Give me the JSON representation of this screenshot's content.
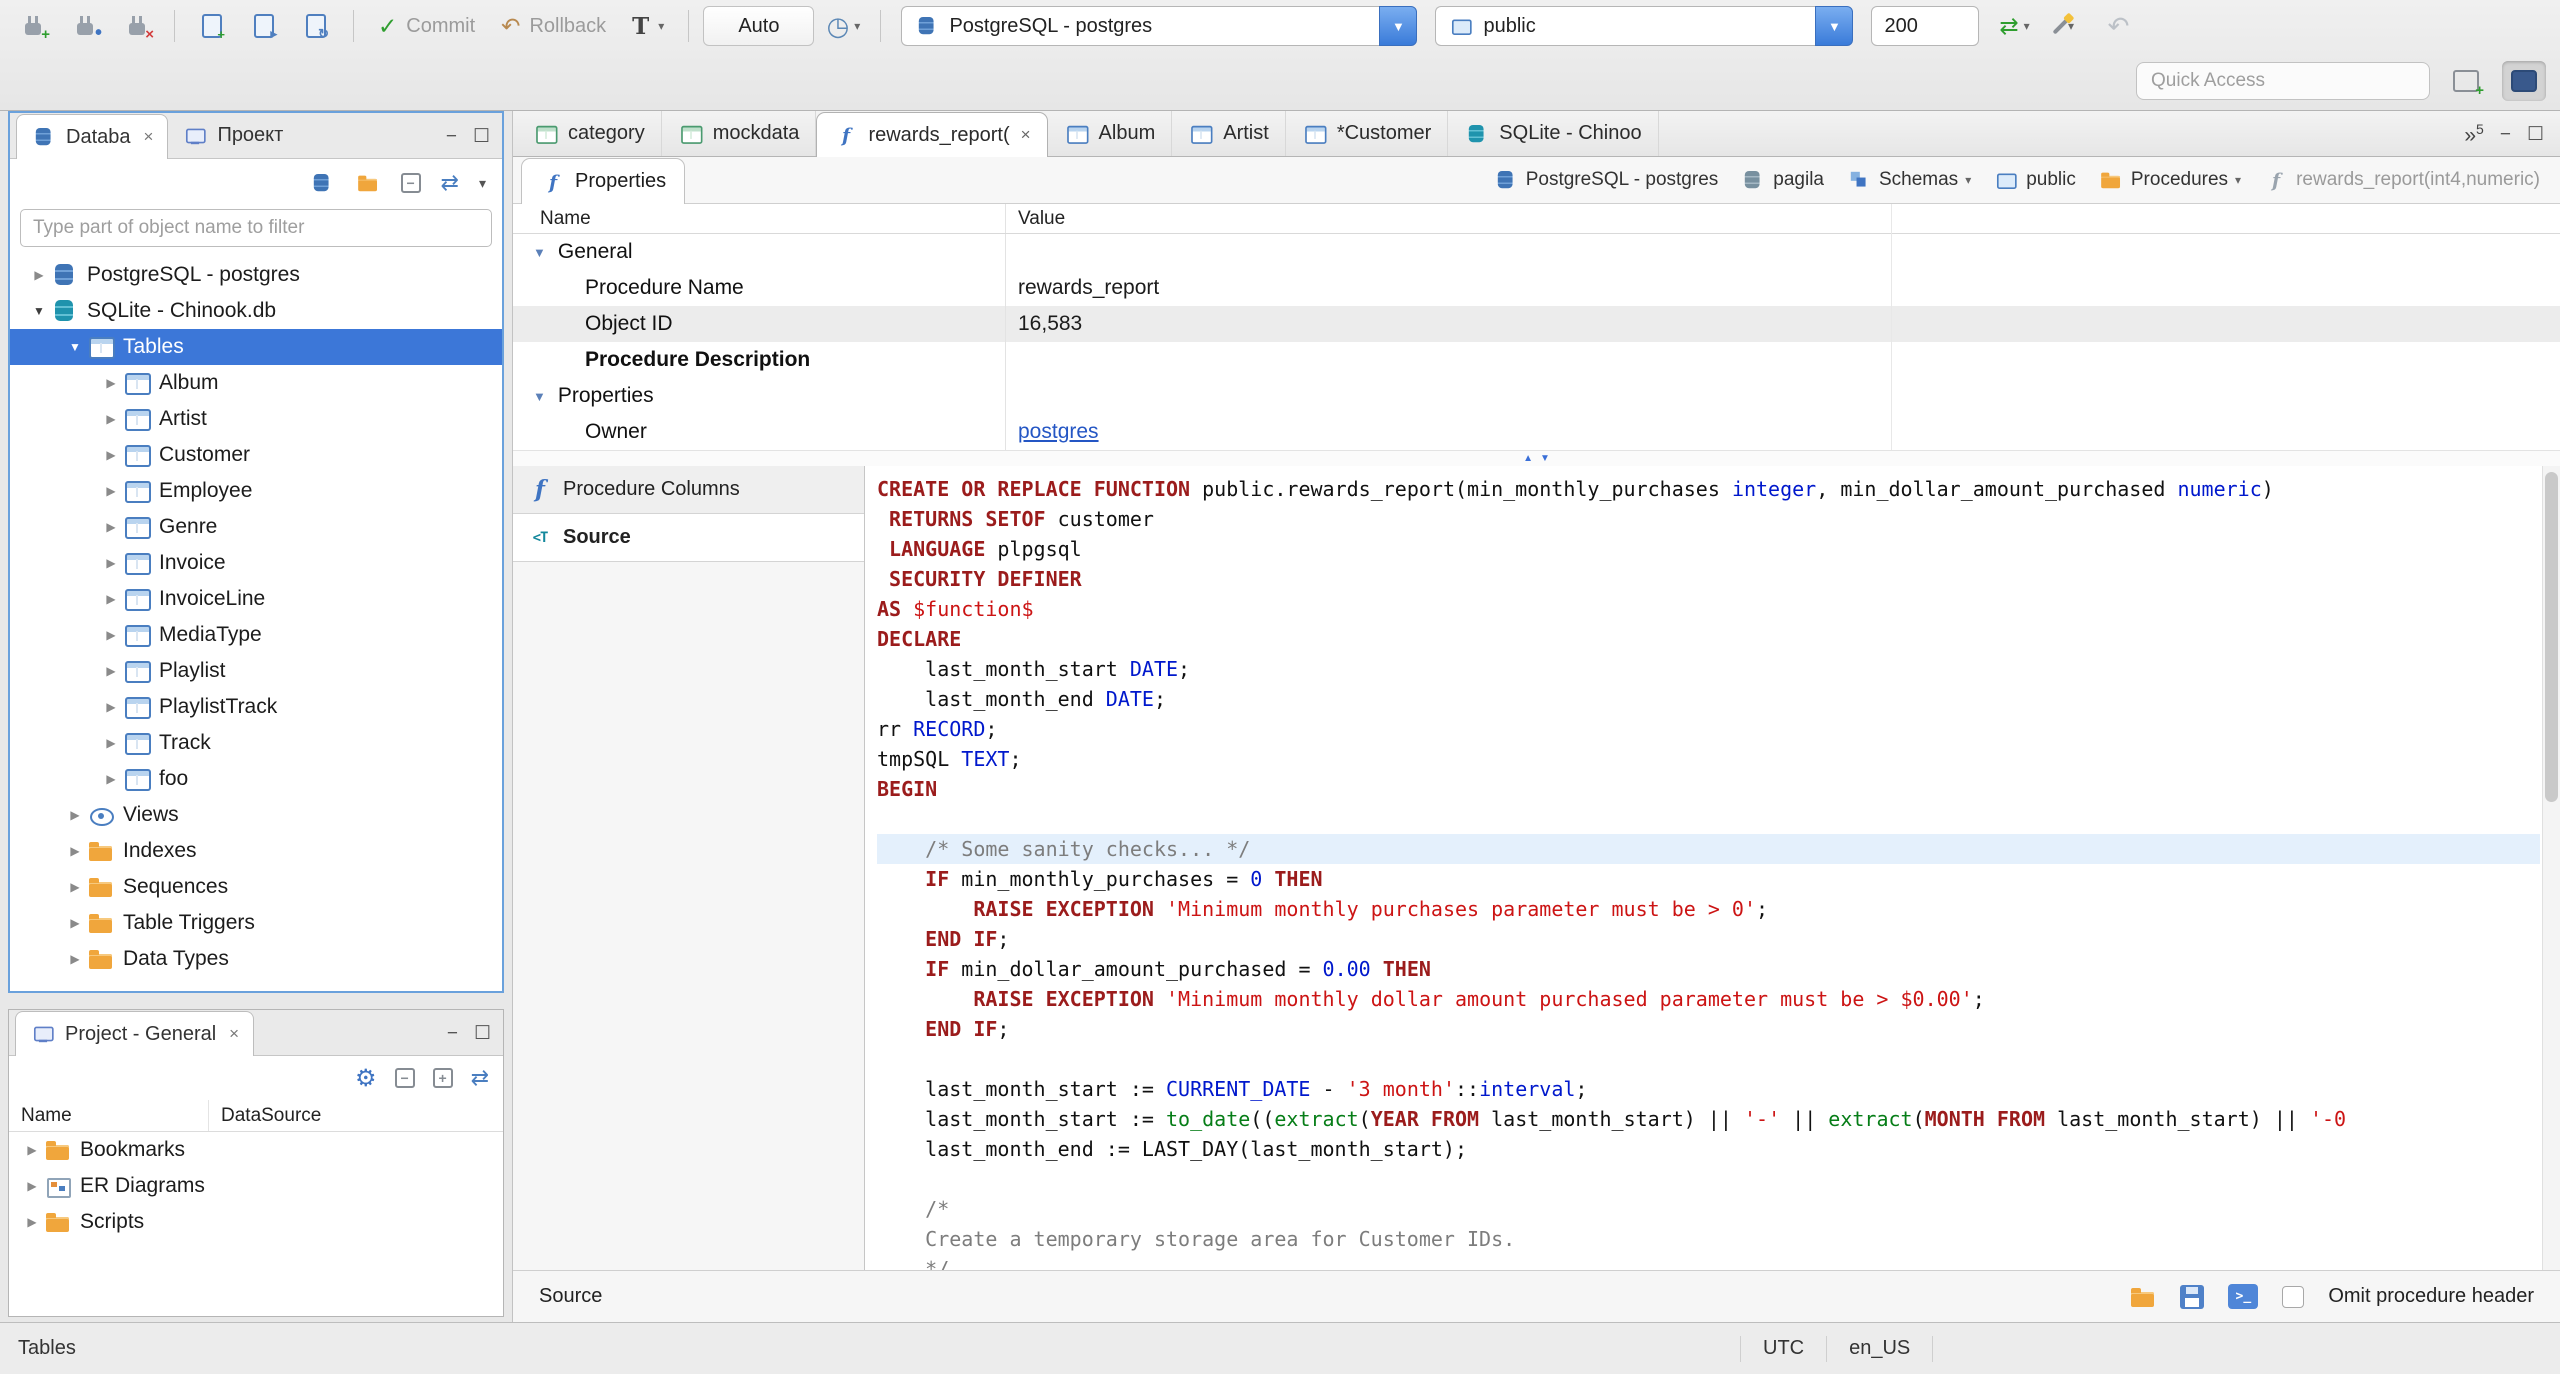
{
  "colors": {
    "selection_blue": "#3c77d8",
    "focus_border": "#6aa1dc",
    "keyword": "#9b1c1c",
    "string": "#cc1414",
    "type": "#0018cc",
    "comment": "#7d7d7d",
    "function": "#067d17",
    "link": "#2456c4",
    "current_line": "#e4f0fc",
    "folder_orange": "#f0a63c"
  },
  "toolbar": {
    "commit_label": "Commit",
    "rollback_label": "Rollback",
    "transaction_letter": "T",
    "auto_label": "Auto",
    "connection_value": "PostgreSQL - postgres",
    "schema_value": "public",
    "fetch_size_value": "200",
    "quick_access_placeholder": "Quick Access"
  },
  "sidebar": {
    "tabs": [
      {
        "label": "Databa",
        "active": true
      },
      {
        "label": "Проект",
        "active": false
      }
    ],
    "filter_placeholder": "Type part of object name to filter",
    "tree": [
      {
        "depth": 0,
        "arrow": "right",
        "icon": "db-pg",
        "label": "PostgreSQL - postgres"
      },
      {
        "depth": 0,
        "arrow": "down",
        "icon": "db-sqlite",
        "label": "SQLite - Chinook.db"
      },
      {
        "depth": 1,
        "arrow": "down",
        "icon": "table",
        "label": "Tables",
        "selected": true
      },
      {
        "depth": 2,
        "arrow": "right",
        "icon": "table",
        "label": "Album"
      },
      {
        "depth": 2,
        "arrow": "right",
        "icon": "table",
        "label": "Artist"
      },
      {
        "depth": 2,
        "arrow": "right",
        "icon": "table",
        "label": "Customer"
      },
      {
        "depth": 2,
        "arrow": "right",
        "icon": "table",
        "label": "Employee"
      },
      {
        "depth": 2,
        "arrow": "right",
        "icon": "table",
        "label": "Genre"
      },
      {
        "depth": 2,
        "arrow": "right",
        "icon": "table",
        "label": "Invoice"
      },
      {
        "depth": 2,
        "arrow": "right",
        "icon": "table",
        "label": "InvoiceLine"
      },
      {
        "depth": 2,
        "arrow": "right",
        "icon": "table",
        "label": "MediaType"
      },
      {
        "depth": 2,
        "arrow": "right",
        "icon": "table",
        "label": "Playlist"
      },
      {
        "depth": 2,
        "arrow": "right",
        "icon": "table",
        "label": "PlaylistTrack"
      },
      {
        "depth": 2,
        "arrow": "right",
        "icon": "table",
        "label": "Track"
      },
      {
        "depth": 2,
        "arrow": "right",
        "icon": "table",
        "label": "foo"
      },
      {
        "depth": 1,
        "arrow": "right",
        "icon": "views",
        "label": "Views"
      },
      {
        "depth": 1,
        "arrow": "right",
        "icon": "folder",
        "label": "Indexes"
      },
      {
        "depth": 1,
        "arrow": "right",
        "icon": "folder",
        "label": "Sequences"
      },
      {
        "depth": 1,
        "arrow": "right",
        "icon": "folder",
        "label": "Table Triggers"
      },
      {
        "depth": 1,
        "arrow": "right",
        "icon": "folder",
        "label": "Data Types"
      }
    ]
  },
  "project": {
    "title": "Project - General",
    "columns": [
      "Name",
      "DataSource"
    ],
    "items": [
      {
        "icon": "folder",
        "label": "Bookmarks"
      },
      {
        "icon": "erd",
        "label": "ER Diagrams"
      },
      {
        "icon": "folder",
        "label": "Scripts"
      }
    ]
  },
  "editor": {
    "tabs": [
      {
        "icon": "grid",
        "label": "category"
      },
      {
        "icon": "grid",
        "label": "mockdata"
      },
      {
        "icon": "fx",
        "label": "rewards_report(",
        "active": true,
        "close": true
      },
      {
        "icon": "table",
        "label": "Album"
      },
      {
        "icon": "table",
        "label": "Artist"
      },
      {
        "icon": "table",
        "label": "*Customer"
      },
      {
        "icon": "db-sqlite",
        "label": "SQLite - Chinoo"
      }
    ],
    "overflow": {
      "chevrons": "»",
      "count": "5"
    },
    "properties_tab_label": "Properties",
    "breadcrumb": [
      {
        "icon": "db-pg",
        "label": "PostgreSQL - postgres"
      },
      {
        "icon": "db-gray",
        "label": "pagila"
      },
      {
        "icon": "schemas",
        "label": "Schemas",
        "caret": true
      },
      {
        "icon": "schema",
        "label": "public"
      },
      {
        "icon": "folder",
        "label": "Procedures",
        "caret": true
      },
      {
        "icon": "fx-muted",
        "label": "rewards_report(int4,numeric)",
        "muted": true
      }
    ],
    "grid": {
      "columns": [
        "Name",
        "Value"
      ],
      "rows": [
        {
          "group": true,
          "name": "General",
          "value": ""
        },
        {
          "name": "Procedure Name",
          "value": "rewards_report"
        },
        {
          "name": "Object ID",
          "value": "16,583",
          "shaded": true
        },
        {
          "name": "Procedure Description",
          "value": "",
          "bold": true
        },
        {
          "group": true,
          "name": "Properties",
          "value": ""
        },
        {
          "name": "Owner",
          "value": "postgres",
          "link": true
        }
      ]
    },
    "panes": [
      {
        "icon": "fx",
        "label": "Procedure Columns"
      },
      {
        "icon": "source",
        "label": "Source",
        "active": true
      }
    ],
    "source": {
      "lines": [
        {
          "t": [
            [
              "k",
              "CREATE OR REPLACE FUNCTION"
            ],
            [
              "p",
              " public.rewards_report(min_monthly_purchases "
            ],
            [
              "y",
              "integer"
            ],
            [
              "p",
              ", min_dollar_amount_purchased "
            ],
            [
              "y",
              "numeric"
            ],
            [
              "p",
              ")"
            ]
          ]
        },
        {
          "t": [
            [
              "p",
              " "
            ],
            [
              "k",
              "RETURNS SETOF"
            ],
            [
              "p",
              " customer"
            ]
          ]
        },
        {
          "t": [
            [
              "p",
              " "
            ],
            [
              "k",
              "LANGUAGE"
            ],
            [
              "p",
              " plpgsql"
            ]
          ]
        },
        {
          "t": [
            [
              "p",
              " "
            ],
            [
              "k",
              "SECURITY DEFINER"
            ]
          ]
        },
        {
          "t": [
            [
              "k",
              "AS"
            ],
            [
              "p",
              " "
            ],
            [
              "s",
              "$function$"
            ]
          ]
        },
        {
          "t": [
            [
              "k",
              "DECLARE"
            ]
          ]
        },
        {
          "t": [
            [
              "p",
              "    last_month_start "
            ],
            [
              "y",
              "DATE"
            ],
            [
              "p",
              ";"
            ]
          ]
        },
        {
          "t": [
            [
              "p",
              "    last_month_end "
            ],
            [
              "y",
              "DATE"
            ],
            [
              "p",
              ";"
            ]
          ]
        },
        {
          "t": [
            [
              "p",
              "rr "
            ],
            [
              "y",
              "RECORD"
            ],
            [
              "p",
              ";"
            ]
          ]
        },
        {
          "t": [
            [
              "p",
              "tmpSQL "
            ],
            [
              "y",
              "TEXT"
            ],
            [
              "p",
              ";"
            ]
          ]
        },
        {
          "t": [
            [
              "k",
              "BEGIN"
            ]
          ]
        },
        {
          "t": []
        },
        {
          "hl": true,
          "t": [
            [
              "c",
              "    /* Some sanity checks... */"
            ]
          ]
        },
        {
          "t": [
            [
              "p",
              "    "
            ],
            [
              "k",
              "IF"
            ],
            [
              "p",
              " min_monthly_purchases = "
            ],
            [
              "n",
              "0"
            ],
            [
              "p",
              " "
            ],
            [
              "k",
              "THEN"
            ]
          ]
        },
        {
          "t": [
            [
              "p",
              "        "
            ],
            [
              "k",
              "RAISE EXCEPTION"
            ],
            [
              "p",
              " "
            ],
            [
              "s",
              "'Minimum monthly purchases parameter must be > 0'"
            ],
            [
              "p",
              ";"
            ]
          ]
        },
        {
          "t": [
            [
              "p",
              "    "
            ],
            [
              "k",
              "END IF"
            ],
            [
              "p",
              ";"
            ]
          ]
        },
        {
          "t": [
            [
              "p",
              "    "
            ],
            [
              "k",
              "IF"
            ],
            [
              "p",
              " min_dollar_amount_purchased = "
            ],
            [
              "n",
              "0.00"
            ],
            [
              "p",
              " "
            ],
            [
              "k",
              "THEN"
            ]
          ]
        },
        {
          "t": [
            [
              "p",
              "        "
            ],
            [
              "k",
              "RAISE EXCEPTION"
            ],
            [
              "p",
              " "
            ],
            [
              "s",
              "'Minimum monthly dollar amount purchased parameter must be > $0.00'"
            ],
            [
              "p",
              ";"
            ]
          ]
        },
        {
          "t": [
            [
              "p",
              "    "
            ],
            [
              "k",
              "END IF"
            ],
            [
              "p",
              ";"
            ]
          ]
        },
        {
          "t": []
        },
        {
          "t": [
            [
              "p",
              "    last_month_start := "
            ],
            [
              "y",
              "CURRENT_DATE"
            ],
            [
              "p",
              " - "
            ],
            [
              "s",
              "'3 month'"
            ],
            [
              "p",
              "::"
            ],
            [
              "y",
              "interval"
            ],
            [
              "p",
              ";"
            ]
          ]
        },
        {
          "t": [
            [
              "p",
              "    last_month_start := "
            ],
            [
              "f",
              "to_date"
            ],
            [
              "p",
              "(("
            ],
            [
              "f",
              "extract"
            ],
            [
              "p",
              "("
            ],
            [
              "k",
              "YEAR FROM"
            ],
            [
              "p",
              " last_month_start) || "
            ],
            [
              "s",
              "'-'"
            ],
            [
              "p",
              " || "
            ],
            [
              "f",
              "extract"
            ],
            [
              "p",
              "("
            ],
            [
              "k",
              "MONTH FROM"
            ],
            [
              "p",
              " last_month_start) || "
            ],
            [
              "s",
              "'-0"
            ]
          ]
        },
        {
          "t": [
            [
              "p",
              "    last_month_end := LAST_DAY(last_month_start);"
            ]
          ]
        },
        {
          "t": []
        },
        {
          "t": [
            [
              "c",
              "    /*"
            ]
          ]
        },
        {
          "t": [
            [
              "c",
              "    Create a temporary storage area for Customer IDs."
            ]
          ]
        },
        {
          "t": [
            [
              "c",
              "    */"
            ]
          ]
        }
      ]
    },
    "bottom": {
      "label": "Source",
      "omit_label": "Omit procedure header"
    }
  },
  "statusbar": {
    "left": "Tables",
    "timezone": "UTC",
    "locale": "en_US"
  }
}
